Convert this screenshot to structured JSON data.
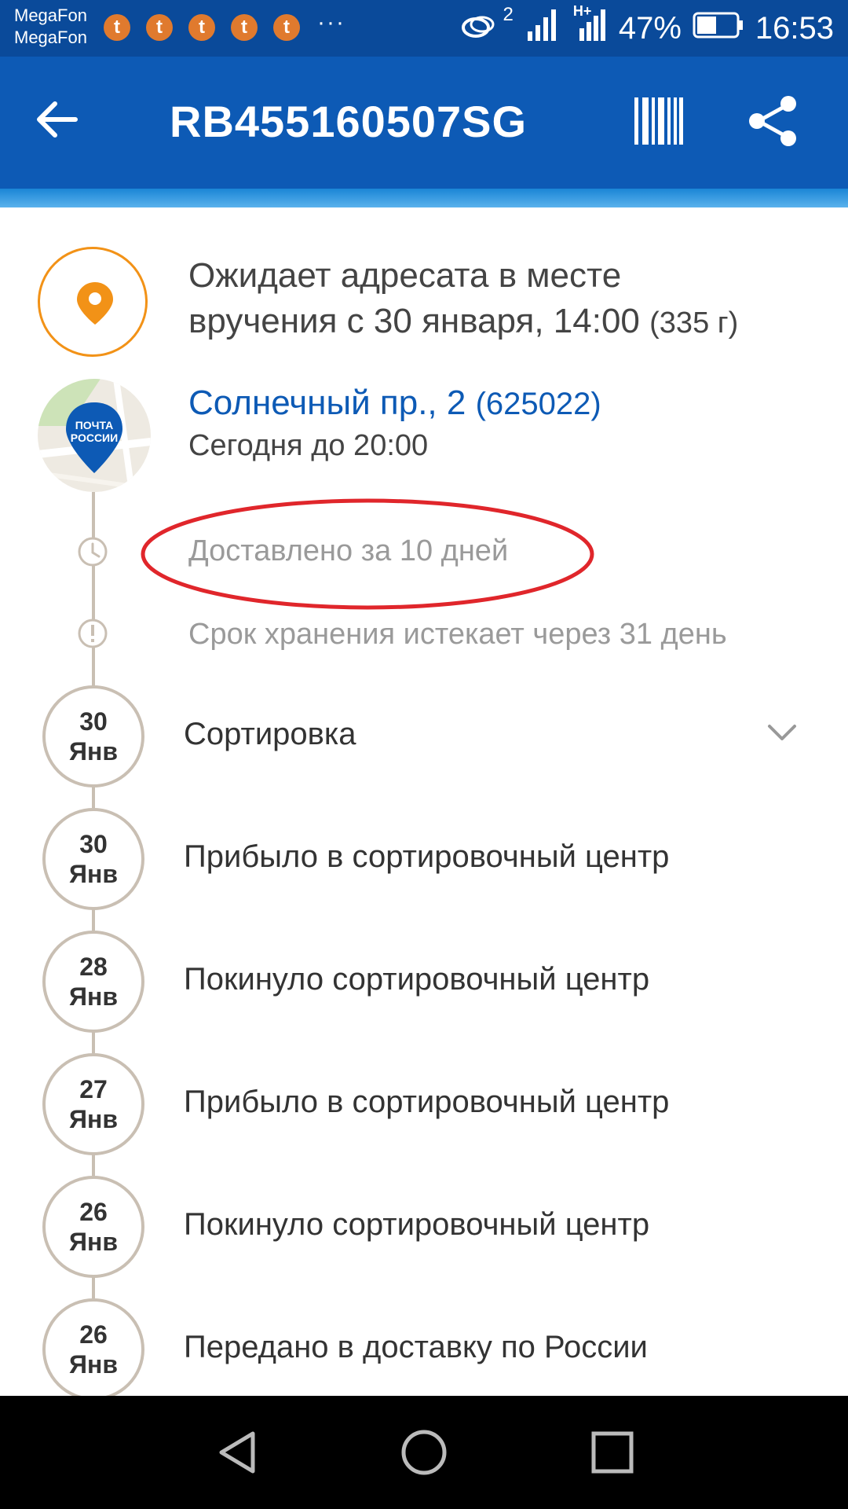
{
  "status_bar": {
    "carrier_1": "MegaFon",
    "carrier_2": "MegaFon",
    "notification_glyph": "t",
    "overflow_dots": "···",
    "signal_sup": "2",
    "network_type": "H+",
    "battery": "47%",
    "time": "16:53"
  },
  "app_bar": {
    "title": "RB455160507SG",
    "back_icon": "arrow-left-icon",
    "barcode_icon": "barcode-icon",
    "share_icon": "share-icon",
    "color": "#0d5ab5"
  },
  "status": {
    "line1": "Ожидает адресата в месте",
    "line2": "вручения с 30 января, 14:00",
    "weight": "(335 г)",
    "icon": "location-pin-icon",
    "accent": "#f29217"
  },
  "office": {
    "address": "Солнечный пр., 2",
    "zip": "(625022)",
    "hours": "Сегодня до 20:00",
    "logo_text_1": "ПОЧТА",
    "logo_text_2": "РОССИИ"
  },
  "info": {
    "delivered_in": "Доставлено за 10 дней",
    "storage_expires": "Срок хранения истекает через 31 день"
  },
  "events": [
    {
      "day": "30",
      "month": "Янв",
      "label": "Сортировка",
      "expandable": true
    },
    {
      "day": "30",
      "month": "Янв",
      "label": "Прибыло в сортировочный центр"
    },
    {
      "day": "28",
      "month": "Янв",
      "label": "Покинуло сортировочный центр"
    },
    {
      "day": "27",
      "month": "Янв",
      "label": "Прибыло в сортировочный центр"
    },
    {
      "day": "26",
      "month": "Янв",
      "label": "Покинуло сортировочный центр"
    },
    {
      "day": "26",
      "month": "Янв",
      "label": "Передано в доставку по России"
    }
  ]
}
